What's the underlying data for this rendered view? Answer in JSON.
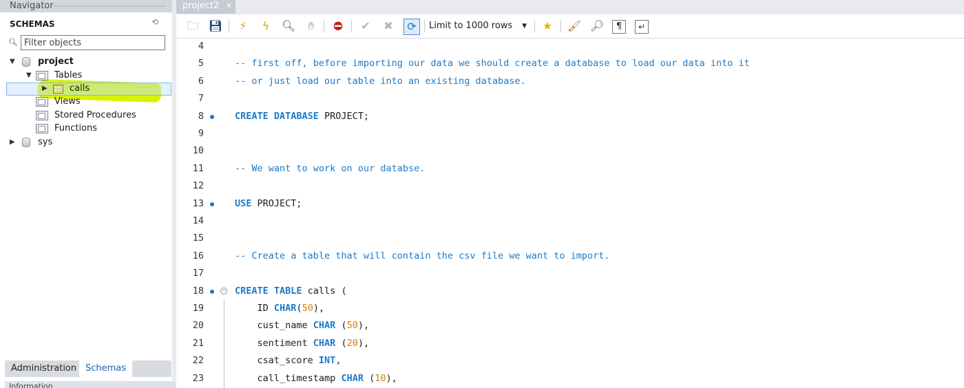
{
  "navigator": {
    "title": "Navigator",
    "schemas_label": "SCHEMAS",
    "filter_placeholder": "Filter objects",
    "tree": {
      "project": "project",
      "tables": "Tables",
      "calls": "calls",
      "views": "Views",
      "stored_procedures": "Stored Procedures",
      "functions": "Functions",
      "sys": "sys"
    },
    "bottom_tabs": {
      "administration": "Administration",
      "schemas": "Schemas"
    },
    "info_label": "Information"
  },
  "editor": {
    "tab_label": "project2",
    "limit_rows": "Limit to 1000 rows",
    "highlight_color": "#d8f200",
    "keyword_color": "#1c7ac8",
    "number_color": "#d27f00",
    "lines": [
      {
        "n": "4",
        "parts": []
      },
      {
        "n": "5",
        "parts": [
          [
            "cm",
            "-- first off, before importing our data we should create a database to load our data into it"
          ]
        ]
      },
      {
        "n": "6",
        "parts": [
          [
            "cm",
            "-- or just load our table into an existing database."
          ]
        ]
      },
      {
        "n": "7",
        "parts": []
      },
      {
        "n": "8",
        "dot": true,
        "parts": [
          [
            "kw",
            "CREATE DATABASE "
          ],
          [
            "",
            "PROJECT;"
          ]
        ]
      },
      {
        "n": "9",
        "parts": []
      },
      {
        "n": "10",
        "parts": []
      },
      {
        "n": "11",
        "parts": [
          [
            "cm",
            "-- We want to work on our databse."
          ]
        ]
      },
      {
        "n": "12",
        "parts": []
      },
      {
        "n": "13",
        "dot": true,
        "parts": [
          [
            "kw",
            "USE "
          ],
          [
            "",
            "PROJECT;"
          ]
        ]
      },
      {
        "n": "14",
        "parts": []
      },
      {
        "n": "15",
        "parts": []
      },
      {
        "n": "16",
        "parts": [
          [
            "cm",
            "-- Create a table that will contain the csv file we want to import."
          ]
        ]
      },
      {
        "n": "17",
        "parts": []
      },
      {
        "n": "18",
        "dot": true,
        "fold": true,
        "parts": [
          [
            "kw",
            "CREATE TABLE "
          ],
          [
            "",
            "calls ("
          ]
        ]
      },
      {
        "n": "19",
        "parts": [
          [
            "",
            "    ID "
          ],
          [
            "kw",
            "CHAR"
          ],
          [
            "",
            "("
          ],
          [
            "num",
            "50"
          ],
          [
            "",
            "),"
          ]
        ]
      },
      {
        "n": "20",
        "parts": [
          [
            "",
            "    cust_name "
          ],
          [
            "kw",
            "CHAR"
          ],
          [
            "",
            " ("
          ],
          [
            "num",
            "50"
          ],
          [
            "",
            "),"
          ]
        ]
      },
      {
        "n": "21",
        "parts": [
          [
            "",
            "    sentiment "
          ],
          [
            "kw",
            "CHAR"
          ],
          [
            "",
            " ("
          ],
          [
            "num",
            "20"
          ],
          [
            "",
            "),"
          ]
        ]
      },
      {
        "n": "22",
        "parts": [
          [
            "",
            "    csat_score "
          ],
          [
            "kw",
            "INT"
          ],
          [
            "",
            ","
          ]
        ]
      },
      {
        "n": "23",
        "parts": [
          [
            "",
            "    call_timestamp "
          ],
          [
            "kw",
            "CHAR"
          ],
          [
            "",
            " ("
          ],
          [
            "num",
            "10"
          ],
          [
            "",
            "),"
          ]
        ]
      }
    ]
  },
  "icons": [
    "open-folder-icon",
    "save-icon",
    "execute-icon",
    "execute-current-icon",
    "explain-icon",
    "stop-icon",
    "toggle-output-icon",
    "commit-icon",
    "rollback-icon",
    "autocommit-icon",
    "favorite-add-icon",
    "beautify-icon",
    "find-icon",
    "invisible-chars-icon",
    "wrap-icon",
    "refresh-icon",
    "search-icon"
  ]
}
